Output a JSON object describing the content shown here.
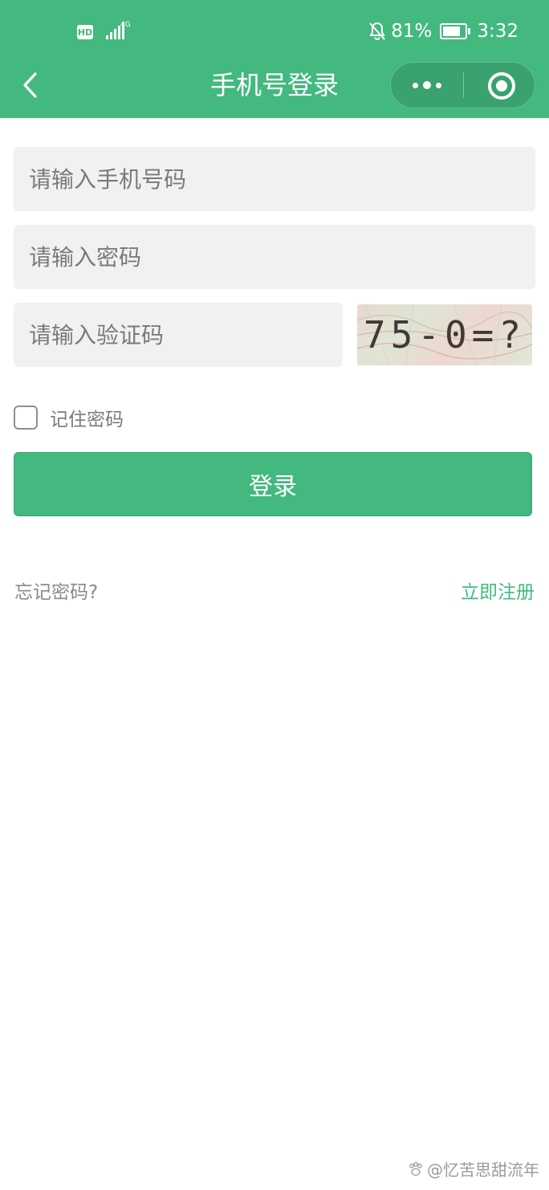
{
  "status_bar": {
    "hd_label": "HD",
    "network_type": "4G",
    "battery_percent": "81%",
    "battery_level": 0.81,
    "time": "3:32"
  },
  "nav": {
    "title": "手机号登录"
  },
  "form": {
    "phone_placeholder": "请输入手机号码",
    "password_placeholder": "请输入密码",
    "captcha_placeholder": "请输入验证码",
    "captcha_image_text": "75-0=?",
    "remember_label": "记住密码",
    "login_label": "登录"
  },
  "links": {
    "forgot_password": "忘记密码?",
    "register": "立即注册"
  },
  "watermark": {
    "text": "@忆苦思甜流年"
  },
  "colors": {
    "brand_green": "#43b97f",
    "field_bg": "#f1f1f1"
  }
}
